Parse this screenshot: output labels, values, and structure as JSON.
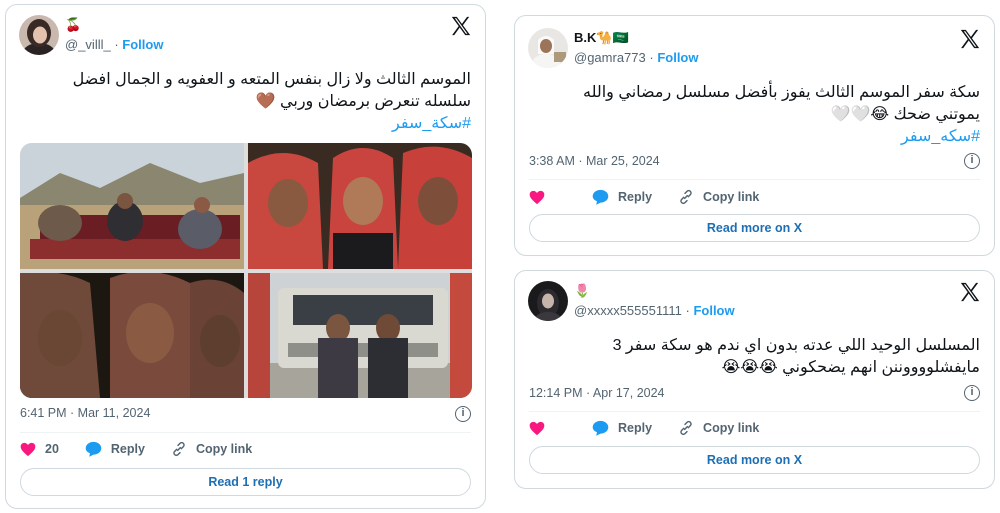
{
  "tweets": [
    {
      "name_emoji": "🍒",
      "handle": "@_villl_",
      "follow": "Follow",
      "text_line1": "الموسم الثالث ولا زال بنفس المتعه و العفويه و الجمال افضل",
      "text_line2": "سلسله تنعرض برمضان وربي 🤎",
      "hashtag": "#سكة_سفر",
      "time": "6:41 PM · Mar 11, 2024",
      "likes": "20",
      "reply": "Reply",
      "copy": "Copy link",
      "cta": "Read 1 reply"
    },
    {
      "name": "B.K🐪🇸🇦",
      "handle": "@gamra773",
      "follow": "Follow",
      "text_line1": "سكة سفر الموسم الثالث يفوز بأفضل مسلسل رمضاني والله",
      "text_line2": "يموتني ضحك 😂🤍🤍",
      "hashtag": "#سكه_سفر",
      "time": "3:38 AM · Mar 25, 2024",
      "reply": "Reply",
      "copy": "Copy link",
      "cta": "Read more on X"
    },
    {
      "name_emoji": "🌷",
      "handle": "@xxxxx555551111",
      "follow": "Follow",
      "text_line1": "المسلسل الوحيد اللي عدته بدون اي ندم هو سكة سفر 3",
      "text_line2": "مايفشلووووننن انهم يضحكوني 😭😭😭",
      "time": "12:14 PM · Apr 17, 2024",
      "reply": "Reply",
      "copy": "Copy link",
      "cta": "Read more on X"
    }
  ],
  "colors": {
    "accent": "#1d9bf0",
    "like": "#f91880",
    "muted": "#536471",
    "border": "#cfd9de"
  }
}
